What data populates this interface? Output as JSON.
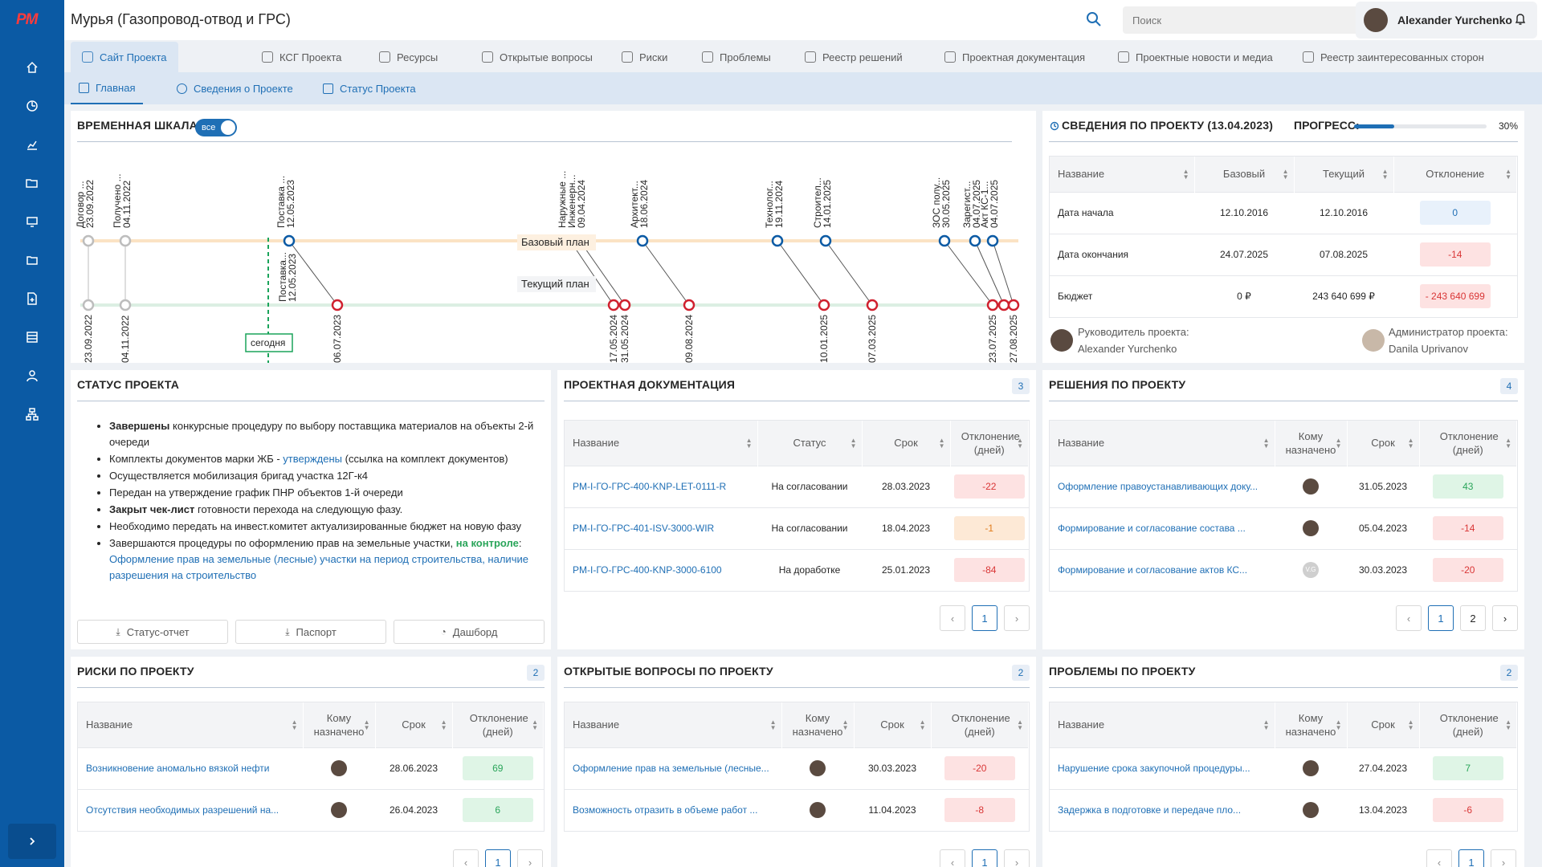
{
  "app": {
    "logo": "PM"
  },
  "header": {
    "title": "Мурья (Газопровод-отвод и ГРС)",
    "search_placeholder": "Поиск",
    "user_name": "Alexander Yurchenko"
  },
  "sidebar": {
    "items": [
      "home-icon",
      "dashboard-icon",
      "chart-icon",
      "folder-open-icon",
      "monitor-icon",
      "folder-icon",
      "file-add-icon",
      "list-icon",
      "user-icon",
      "hierarchy-icon"
    ]
  },
  "tabs": [
    {
      "label": "Сайт Проекта",
      "icon": "eye-icon",
      "active": true
    },
    {
      "label": "КСГ Проекта",
      "icon": "bar-chart-icon"
    },
    {
      "label": "Ресурсы",
      "icon": "settings-icon"
    },
    {
      "label": "Открытые вопросы",
      "icon": "question-icon"
    },
    {
      "label": "Риски",
      "icon": "file-risk-icon"
    },
    {
      "label": "Проблемы",
      "icon": "clock-icon"
    },
    {
      "label": "Реестр решений",
      "icon": "like-icon"
    },
    {
      "label": "Проектная документация",
      "icon": "document-icon"
    },
    {
      "label": "Проектные новости и медиа",
      "icon": "news-icon"
    },
    {
      "label": "Реестр заинтересованных сторон",
      "icon": "stakeholders-icon"
    }
  ],
  "subtabs": [
    {
      "label": "Главная",
      "icon": "home-icon",
      "active": true
    },
    {
      "label": "Сведения о Проекте",
      "icon": "info-icon"
    },
    {
      "label": "Статус Проекта",
      "icon": "list-icon"
    }
  ],
  "timeline": {
    "title": "ВРЕМЕННАЯ ШКАЛА",
    "toggle_label": "все",
    "baseline_label": "Базовый план",
    "current_label": "Текущий план",
    "today_label": "сегодня",
    "top_labels": [
      {
        "name": "Договор ...",
        "date": "23.09.2022"
      },
      {
        "name": "Получено ...",
        "date": "04.11.2022"
      },
      {
        "name": "Поставка ...",
        "date": "12.05.2023"
      },
      {
        "name": "Наружные ...",
        "date": ""
      },
      {
        "name": "Инженерн...",
        "date": "09.04.2024"
      },
      {
        "name": "Архитект...",
        "date": "18.06.2024"
      },
      {
        "name": "Технолог...",
        "date": "19.11.2024"
      },
      {
        "name": "Строител...",
        "date": "14.01.2025"
      },
      {
        "name": "ЗОС полу...",
        "date": "30.05.2025"
      },
      {
        "name": "Зарегист...",
        "date": "04.07.2025"
      },
      {
        "name": "Акт КС-1...",
        "date": "04.07.2025"
      }
    ],
    "bottom_dates": [
      "23.09.2022",
      "04.11.2022",
      "06.07.2023",
      "17.05.2024",
      "31.05.2024",
      "09.08.2024",
      "10.01.2025",
      "07.03.2025",
      "23.07.2025",
      "27.08.2025"
    ],
    "extra_label": {
      "name": "Поставка...",
      "date": "12.05.2023"
    }
  },
  "info": {
    "title": "СВЕДЕНИЯ ПО ПРОЕКТУ (13.04.2023)",
    "progress_label": "ПРОГРЕСС:",
    "progress_value": 30,
    "progress_text": "30%",
    "columns": [
      "Название",
      "Базовый",
      "Текущий",
      "Отклонение"
    ],
    "rows": [
      {
        "name": "Дата начала",
        "base": "12.10.2016",
        "current": "12.10.2016",
        "dev": "0",
        "kind": "zero"
      },
      {
        "name": "Дата окончания",
        "base": "24.07.2025",
        "current": "07.08.2025",
        "dev": "-14",
        "kind": "neg"
      },
      {
        "name": "Бюджет",
        "base": "0 ₽",
        "current": "243 640 699 ₽",
        "dev": "- 243 640 699",
        "kind": "neg"
      }
    ],
    "manager_label": "Руководитель проекта:",
    "manager_name": "Alexander Yurchenko",
    "admin_label": "Администратор проекта:",
    "admin_name": "Danila Uprivanov"
  },
  "status": {
    "title": "СТАТУС ПРОЕКТА",
    "items": [
      {
        "bold": "Завершены",
        "text": " конкурсные процедуру по выбору поставщика материалов на объекты 2-й очереди",
        "link": "",
        "tail": ""
      },
      {
        "bold": "",
        "text": "Комплекты документов марки ЖБ - ",
        "link": "утверждены",
        "tail": " (ссылка на комплект документов)"
      },
      {
        "bold": "",
        "text": "Осуществляется мобилизация бригад участка 12Г-к4",
        "link": "",
        "tail": ""
      },
      {
        "bold": "",
        "text": "Передан на утверждение график ПНР объектов 1-й очереди",
        "link": "",
        "tail": ""
      },
      {
        "bold": "Закрыт чек-лист",
        "text": " готовности перехода на следующую фазу.",
        "link": "",
        "tail": ""
      },
      {
        "bold": "",
        "text": "Необходимо передать на инвест.комитет актуализированные бюджет на новую фазу",
        "link": "",
        "tail": ""
      },
      {
        "bold": "",
        "text": "Завершаются процедуры по оформлению прав на земельные участки, ",
        "green": "на контроле",
        "after_green": ": ",
        "link": "Оформление прав на земельные (лесные) участки на период строительства, наличие разрешения на строительство",
        "tail": ""
      }
    ],
    "buttons": [
      "Статус-отчет",
      "Паспорт",
      "Дашборд"
    ]
  },
  "docs": {
    "title": "ПРОЕКТНАЯ ДОКУМЕНТАЦИЯ",
    "count": "3",
    "columns": [
      "Название",
      "Статус",
      "Срок",
      "Отклонение (дней)"
    ],
    "rows": [
      {
        "name": "PM-I-ГО-ГРС-400-KNP-LET-0111-R",
        "status": "На согласовании",
        "date": "28.03.2023",
        "dev": "-22",
        "kind": "neg"
      },
      {
        "name": "PM-I-ГО-ГРС-401-ISV-3000-WIR",
        "status": "На согласовании",
        "date": "18.04.2023",
        "dev": "-1",
        "kind": "warn"
      },
      {
        "name": "PM-I-ГО-ГРС-400-KNP-3000-6100",
        "status": "На доработке",
        "date": "25.01.2023",
        "dev": "-84",
        "kind": "neg"
      }
    ],
    "pages": [
      "1"
    ]
  },
  "decisions": {
    "title": "РЕШЕНИЯ ПО ПРОЕКТУ",
    "count": "4",
    "columns": [
      "Название",
      "Кому назначено",
      "Срок",
      "Отклонение (дней)"
    ],
    "rows": [
      {
        "name": "Оформление правоустанавливающих доку...",
        "avatar": "photo",
        "date": "31.05.2023",
        "dev": "43",
        "kind": "pos"
      },
      {
        "name": "Формирование и согласование состава ...",
        "avatar": "photo",
        "date": "05.04.2023",
        "dev": "-14",
        "kind": "neg"
      },
      {
        "name": "Формирование и согласование актов КС...",
        "avatar": "V.G",
        "date": "30.03.2023",
        "dev": "-20",
        "kind": "neg"
      }
    ],
    "pages": [
      "1",
      "2"
    ]
  },
  "risks": {
    "title": "РИСКИ ПО ПРОЕКТУ",
    "count": "2",
    "columns": [
      "Название",
      "Кому назначено",
      "Срок",
      "Отклонение (дней)"
    ],
    "rows": [
      {
        "name": "Возникновение аномально вязкой нефти",
        "date": "28.06.2023",
        "dev": "69",
        "kind": "pos"
      },
      {
        "name": "Отсутствия необходимых разрешений на...",
        "date": "26.04.2023",
        "dev": "6",
        "kind": "pos"
      }
    ],
    "pages": [
      "1"
    ]
  },
  "questions": {
    "title": "ОТКРЫТЫЕ ВОПРОСЫ ПО ПРОЕКТУ",
    "count": "2",
    "columns": [
      "Название",
      "Кому назначено",
      "Срок",
      "Отклонение (дней)"
    ],
    "rows": [
      {
        "name": "Оформление прав на земельные (лесные...",
        "date": "30.03.2023",
        "dev": "-20",
        "kind": "neg"
      },
      {
        "name": "Возможность отразить в объеме работ ...",
        "date": "11.04.2023",
        "dev": "-8",
        "kind": "neg"
      }
    ],
    "pages": [
      "1"
    ]
  },
  "problems": {
    "title": "ПРОБЛЕМЫ ПО ПРОЕКТУ",
    "count": "2",
    "columns": [
      "Название",
      "Кому назначено",
      "Срок",
      "Отклонение (дней)"
    ],
    "rows": [
      {
        "name": "Нарушение срока закупочной процедуры...",
        "date": "27.04.2023",
        "dev": "7",
        "kind": "pos"
      },
      {
        "name": "Задержка в подготовке и передаче пло...",
        "date": "13.04.2023",
        "dev": "-6",
        "kind": "neg"
      }
    ],
    "pages": [
      "1"
    ]
  },
  "colors": {
    "primary": "#0b5aa4",
    "accent": "#1f6fb5",
    "danger": "#d0202e",
    "success": "#2aa55a",
    "today": "#1aa35a"
  }
}
